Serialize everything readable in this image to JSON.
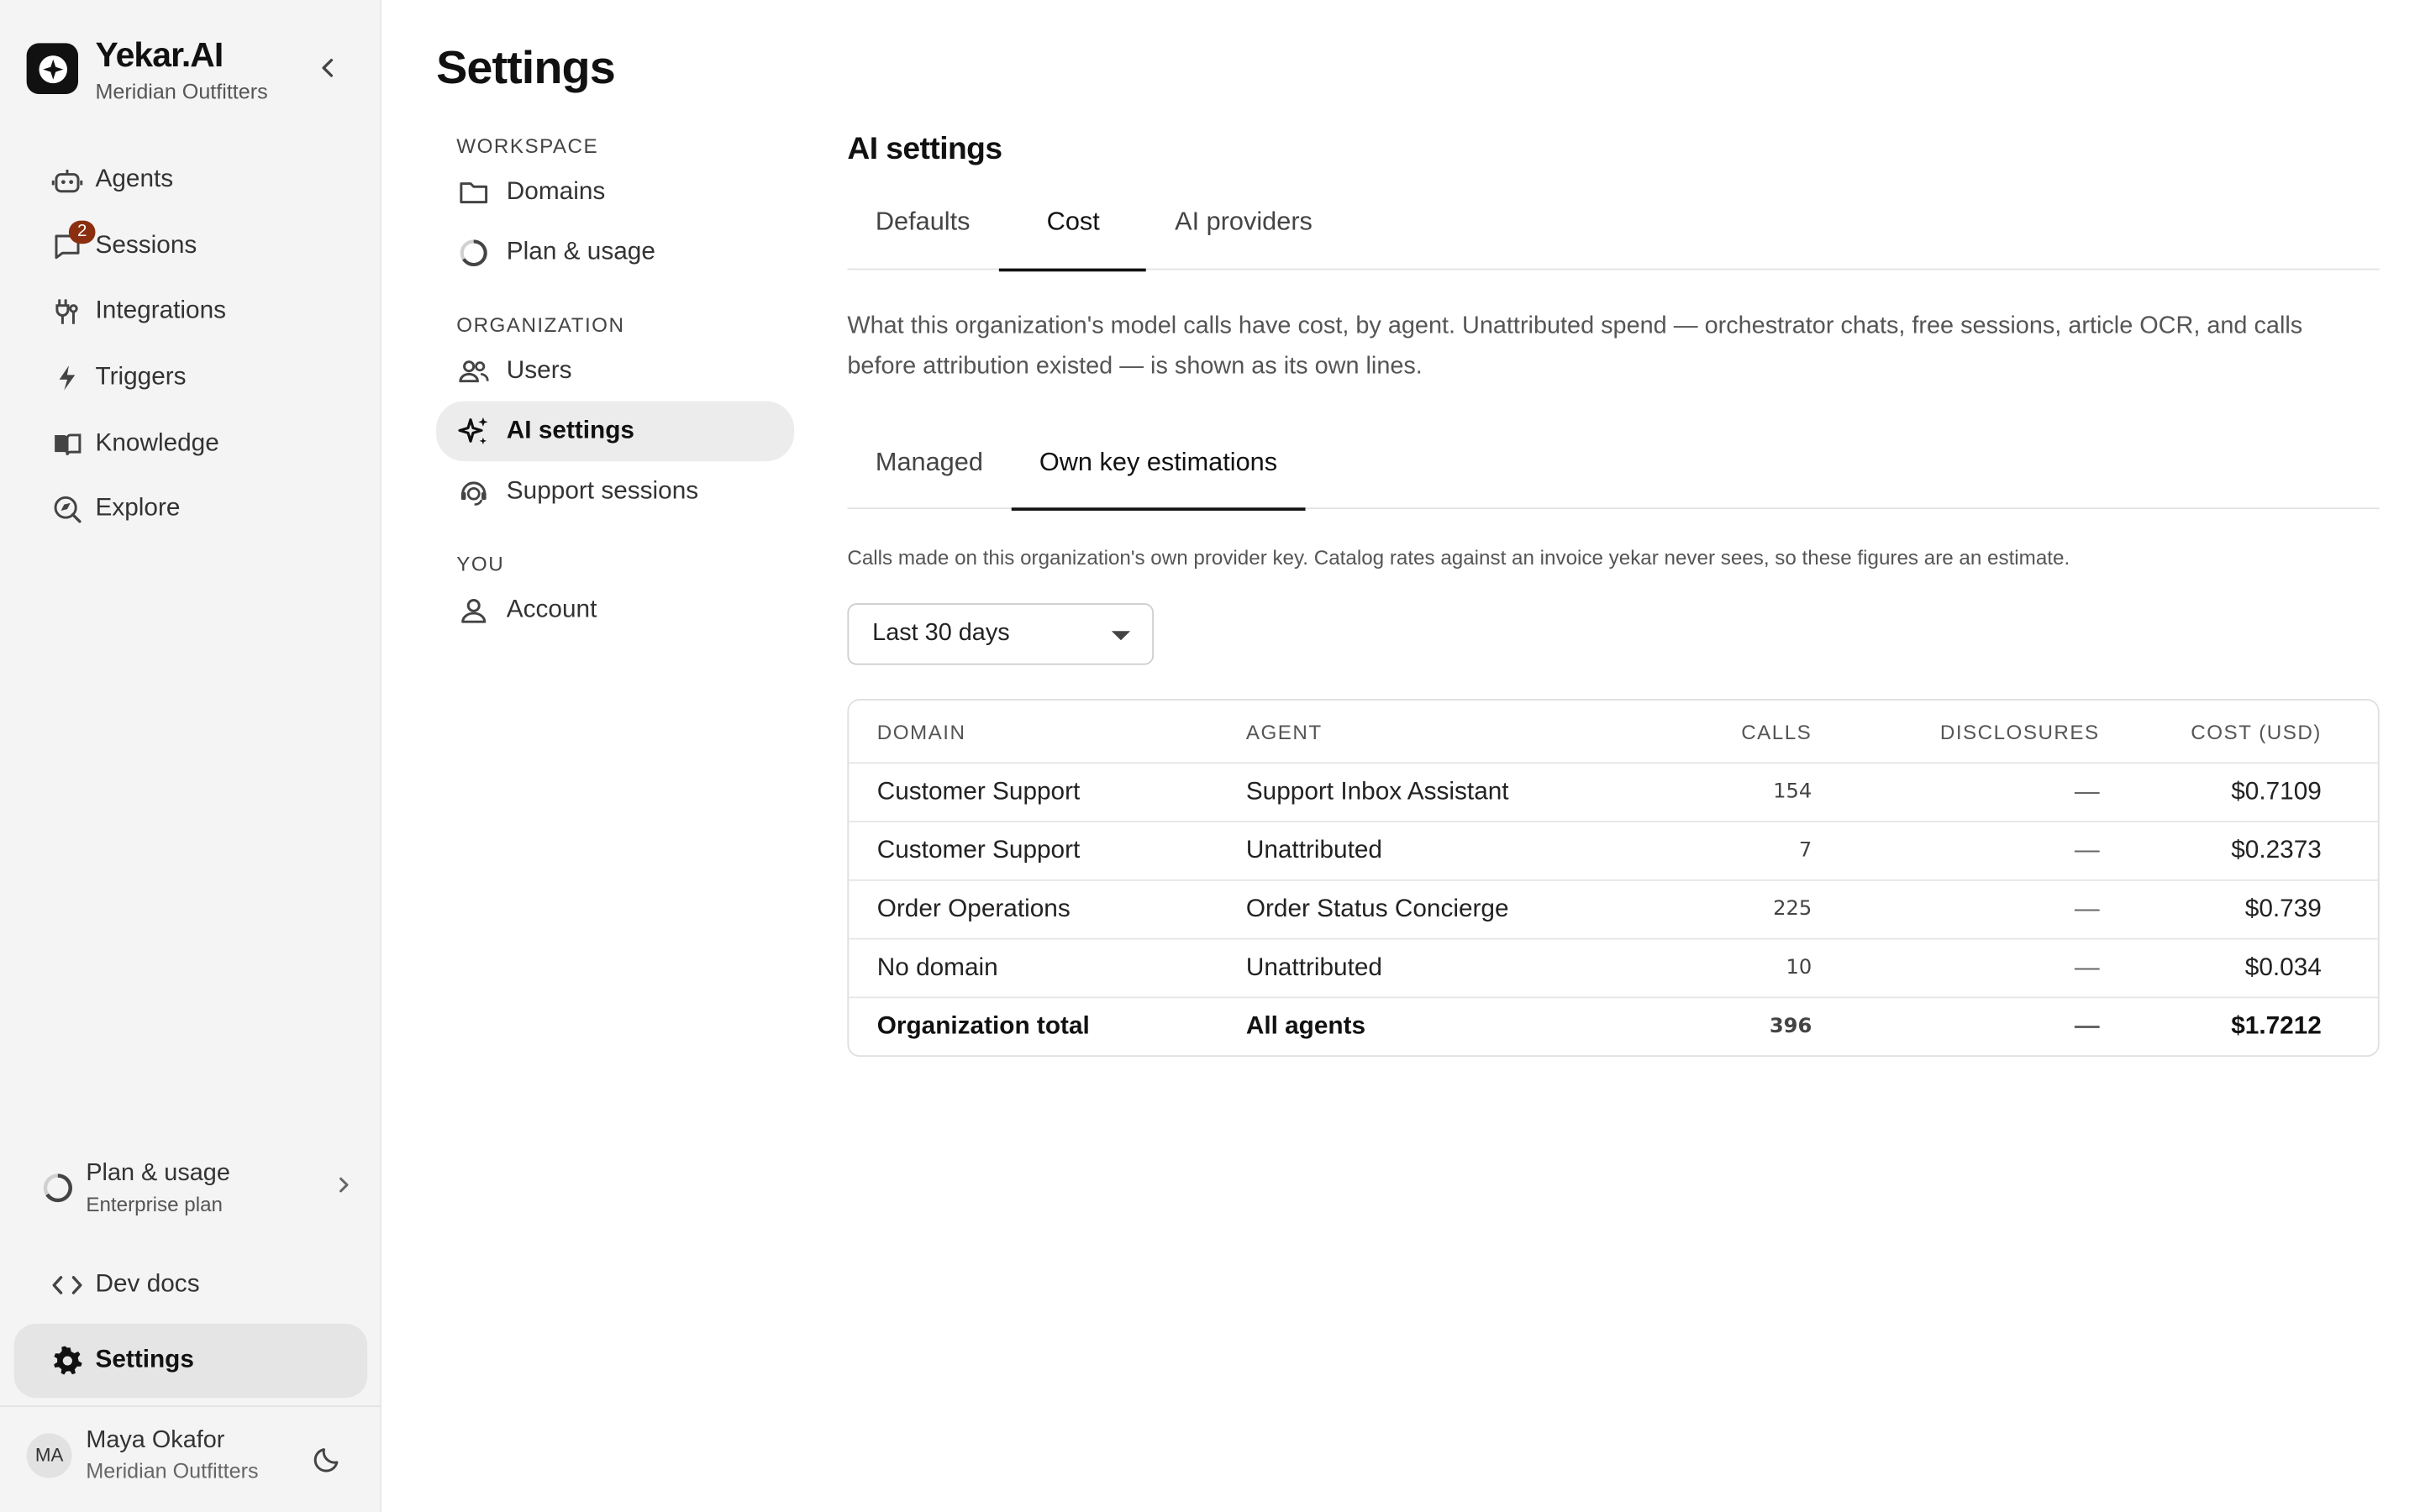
{
  "brand": {
    "name": "Yekar.AI",
    "org": "Meridian Outfitters"
  },
  "nav": {
    "items": [
      {
        "label": "Agents"
      },
      {
        "label": "Sessions",
        "badge": "2"
      },
      {
        "label": "Integrations"
      },
      {
        "label": "Triggers"
      },
      {
        "label": "Knowledge"
      },
      {
        "label": "Explore"
      }
    ],
    "plan": {
      "title": "Plan & usage",
      "subtitle": "Enterprise plan"
    },
    "devdocs": "Dev docs",
    "settings": "Settings"
  },
  "user": {
    "initials": "MA",
    "name": "Maya Okafor",
    "org": "Meridian Outfitters"
  },
  "settings_nav": {
    "title": "Settings",
    "groups": [
      {
        "heading": "WORKSPACE",
        "items": [
          "Domains",
          "Plan & usage"
        ]
      },
      {
        "heading": "ORGANIZATION",
        "items": [
          "Users",
          "AI settings",
          "Support sessions"
        ]
      },
      {
        "heading": "YOU",
        "items": [
          "Account"
        ]
      }
    ]
  },
  "main": {
    "section_title": "AI settings",
    "tabs": [
      "Defaults",
      "Cost",
      "AI providers"
    ],
    "description": "What this organization's model calls have cost, by agent. Unattributed spend — orchestrator chats, free sessions, article OCR, and calls before attribution existed — is shown as its own lines.",
    "subtabs": [
      "Managed",
      "Own key estimations"
    ],
    "note": "Calls made on this organization's own provider key. Catalog rates against an invoice yekar never sees, so these figures are an estimate.",
    "range": "Last 30 days",
    "table": {
      "headers": [
        "DOMAIN",
        "AGENT",
        "CALLS",
        "DISCLOSURES",
        "COST (USD)"
      ],
      "rows": [
        [
          "Customer Support",
          "Support Inbox Assistant",
          "154",
          "—",
          "$0.7109"
        ],
        [
          "Customer Support",
          "Unattributed",
          "7",
          "—",
          "$0.2373"
        ],
        [
          "Order Operations",
          "Order Status Concierge",
          "225",
          "—",
          "$0.739"
        ],
        [
          "No domain",
          "Unattributed",
          "10",
          "—",
          "$0.034"
        ]
      ],
      "total": [
        "Organization total",
        "All agents",
        "396",
        "—",
        "$1.7212"
      ]
    }
  }
}
